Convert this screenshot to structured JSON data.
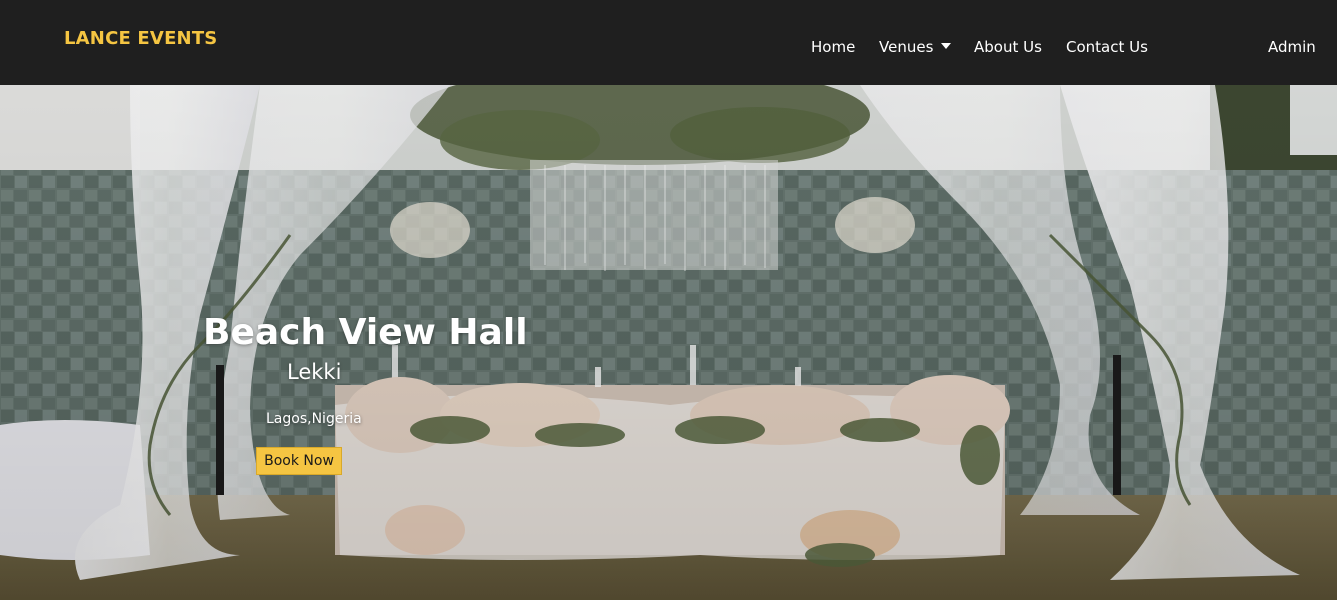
{
  "brand": {
    "name": "LANCE EVENTS",
    "color": "#f5c542"
  },
  "nav": {
    "home": "Home",
    "venues": "Venues",
    "about": "About Us",
    "contact": "Contact Us",
    "admin": "Admin"
  },
  "hero": {
    "title": "Beach View Hall",
    "subtitle": "Lekki",
    "location": "Lagos,Nigeria",
    "button": "Book Now",
    "button_color": "#f5c542"
  },
  "colors": {
    "navbar_bg": "#1f1f1f",
    "nav_text": "#ffffff"
  }
}
